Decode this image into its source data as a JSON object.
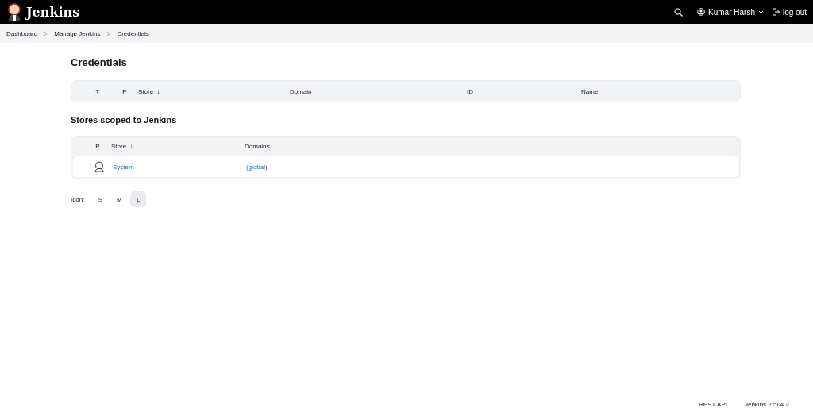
{
  "header": {
    "brand": "Jenkins",
    "user": "Kumar Harsh",
    "logout": "log out"
  },
  "breadcrumbs": [
    {
      "label": "Dashboard"
    },
    {
      "label": "Manage Jenkins"
    },
    {
      "label": "Credentials"
    }
  ],
  "credentials": {
    "title": "Credentials",
    "columns": [
      {
        "label": "T",
        "kind": "center"
      },
      {
        "label": "P",
        "kind": "center"
      },
      {
        "label": "Store",
        "kind": "sort",
        "sort": "↓"
      },
      {
        "label": "Domain",
        "kind": "plain"
      },
      {
        "label": "ID",
        "kind": "plain"
      },
      {
        "label": "Name",
        "kind": "plain"
      }
    ]
  },
  "stores": {
    "title": "Stores scoped to Jenkins",
    "columns": [
      {
        "label": "P",
        "kind": "center"
      },
      {
        "label": "Store",
        "kind": "sort",
        "sort": "↓"
      },
      {
        "label": "Domains",
        "kind": "plain"
      }
    ],
    "rows": [
      {
        "store": "System",
        "domain": "(global)"
      }
    ]
  },
  "icon_size": {
    "label": "Icon:",
    "options": [
      {
        "label": "S",
        "selected": false
      },
      {
        "label": "M",
        "selected": false
      },
      {
        "label": "L",
        "selected": true
      }
    ]
  },
  "footer": {
    "links": [
      "REST API",
      "Jenkins 2.504.2"
    ]
  }
}
